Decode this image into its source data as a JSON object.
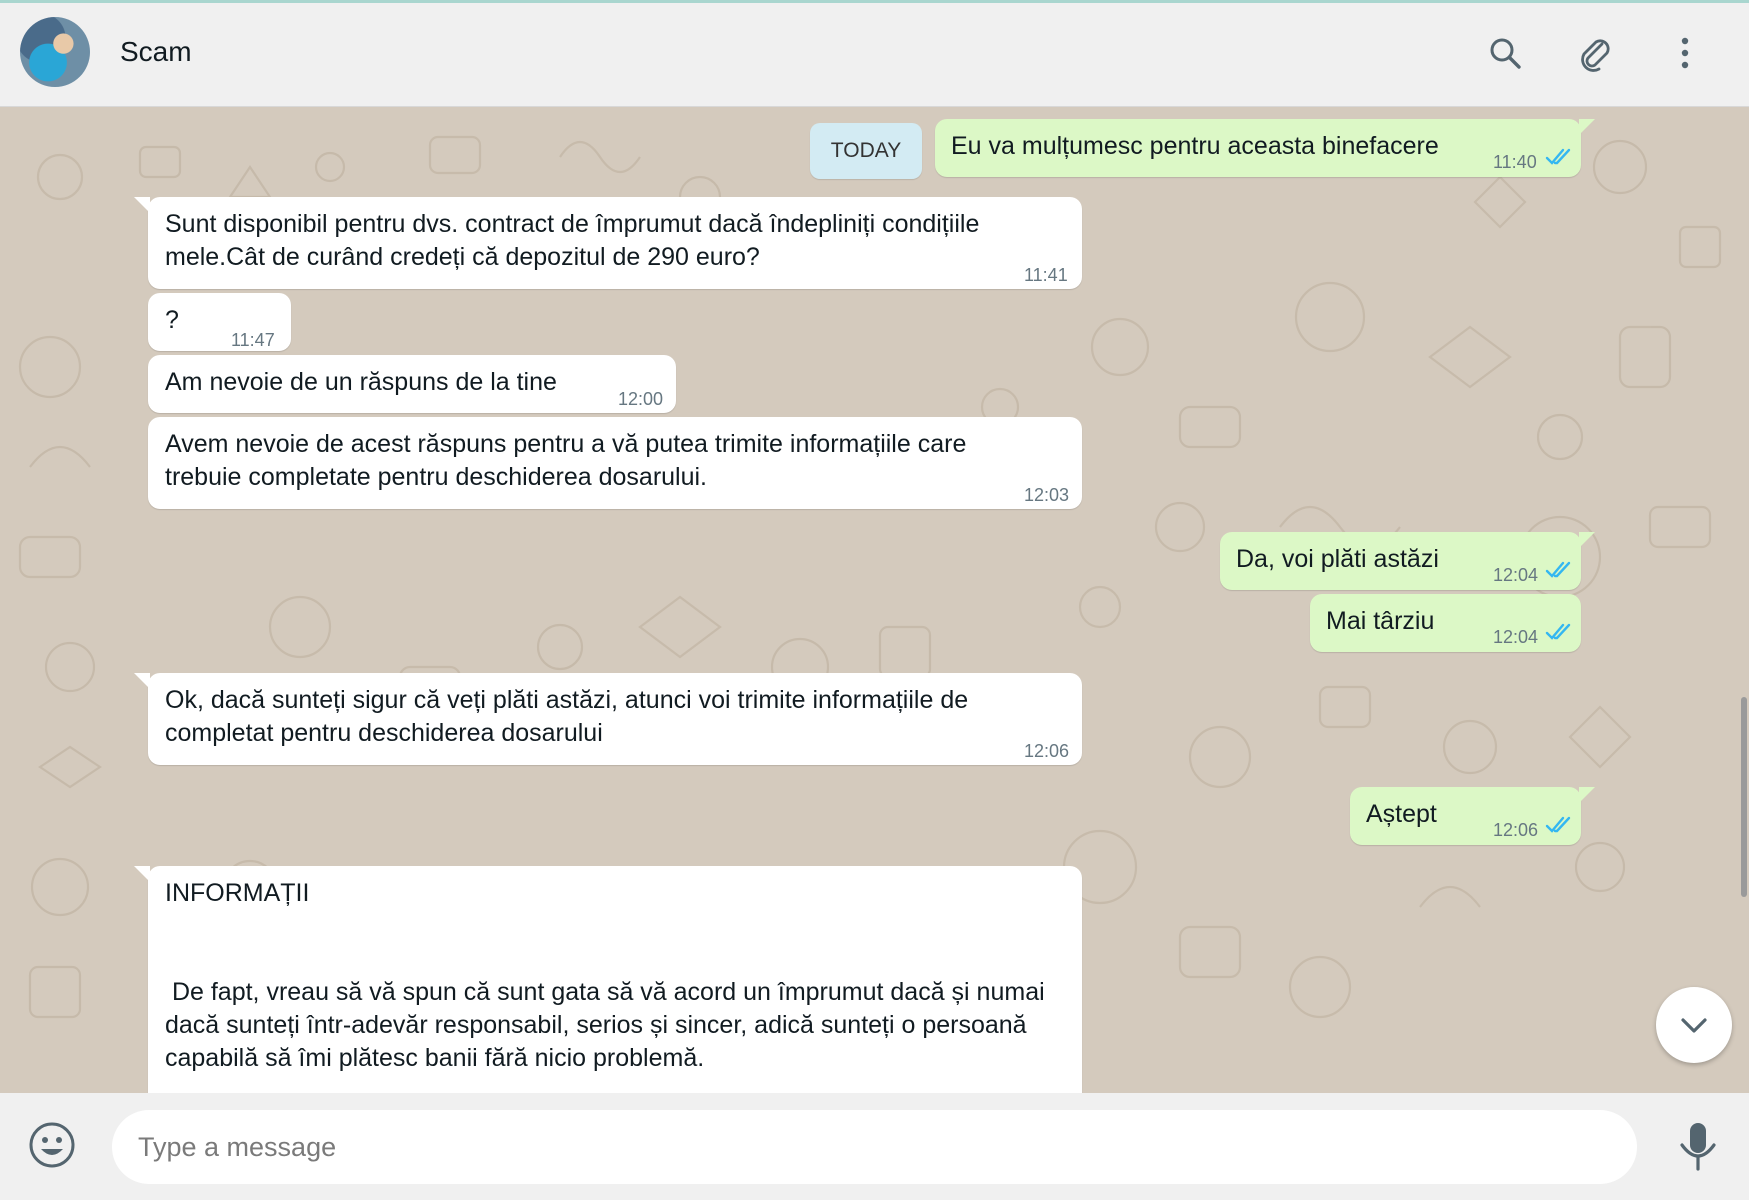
{
  "header": {
    "contact_name": "Scam",
    "icons": [
      "avatar",
      "search-icon",
      "paperclip-icon",
      "more-vert-icon"
    ]
  },
  "chat": {
    "date_chip": "TODAY",
    "messages": [
      {
        "dir": "out",
        "text": "Eu va mulțumesc pentru aceasta binefacere",
        "time": "11:40",
        "status": "read"
      },
      {
        "dir": "in",
        "text": "Sunt disponibil pentru dvs. contract de împrumut dacă îndepliniți condițiile mele.Cât de curând credeți că depozitul de 290 euro?",
        "time": "11:41"
      },
      {
        "dir": "in",
        "text": "?",
        "time": "11:47"
      },
      {
        "dir": "in",
        "text": "Am nevoie de un răspuns de la tine",
        "time": "12:00"
      },
      {
        "dir": "in",
        "text": "Avem nevoie de acest răspuns pentru a vă putea trimite informațiile care trebuie completate pentru deschiderea dosarului.",
        "time": "12:03"
      },
      {
        "dir": "out",
        "text": "Da, voi plăti astăzi",
        "time": "12:04",
        "status": "read"
      },
      {
        "dir": "out",
        "text": "Mai târziu",
        "time": "12:04",
        "status": "read"
      },
      {
        "dir": "in",
        "text": "Ok, dacă sunteți sigur că veți plăti astăzi, atunci voi trimite informațiile de completat pentru deschiderea dosarului",
        "time": "12:06"
      },
      {
        "dir": "out",
        "text": "Aștept",
        "time": "12:06",
        "status": "read"
      },
      {
        "dir": "in",
        "title": "INFORMAȚII",
        "text": " De fapt, vreau să vă spun că sunt gata să vă acord un împrumut dacă și numai dacă sunteți într-adevăr responsabil, serios și sincer, adică sunteți o persoană capabilă să îmi plătesc banii fără nicio problemă."
      }
    ]
  },
  "composer": {
    "placeholder": "Type a message",
    "icons": [
      "emoji-icon",
      "mic-icon"
    ]
  },
  "colors": {
    "incoming_bubble": "#ffffff",
    "outgoing_bubble": "#dcf8c6",
    "read_ticks": "#34b7f1",
    "date_chip": "#d3ebf3",
    "chat_wallpaper": "#d4cabd"
  }
}
